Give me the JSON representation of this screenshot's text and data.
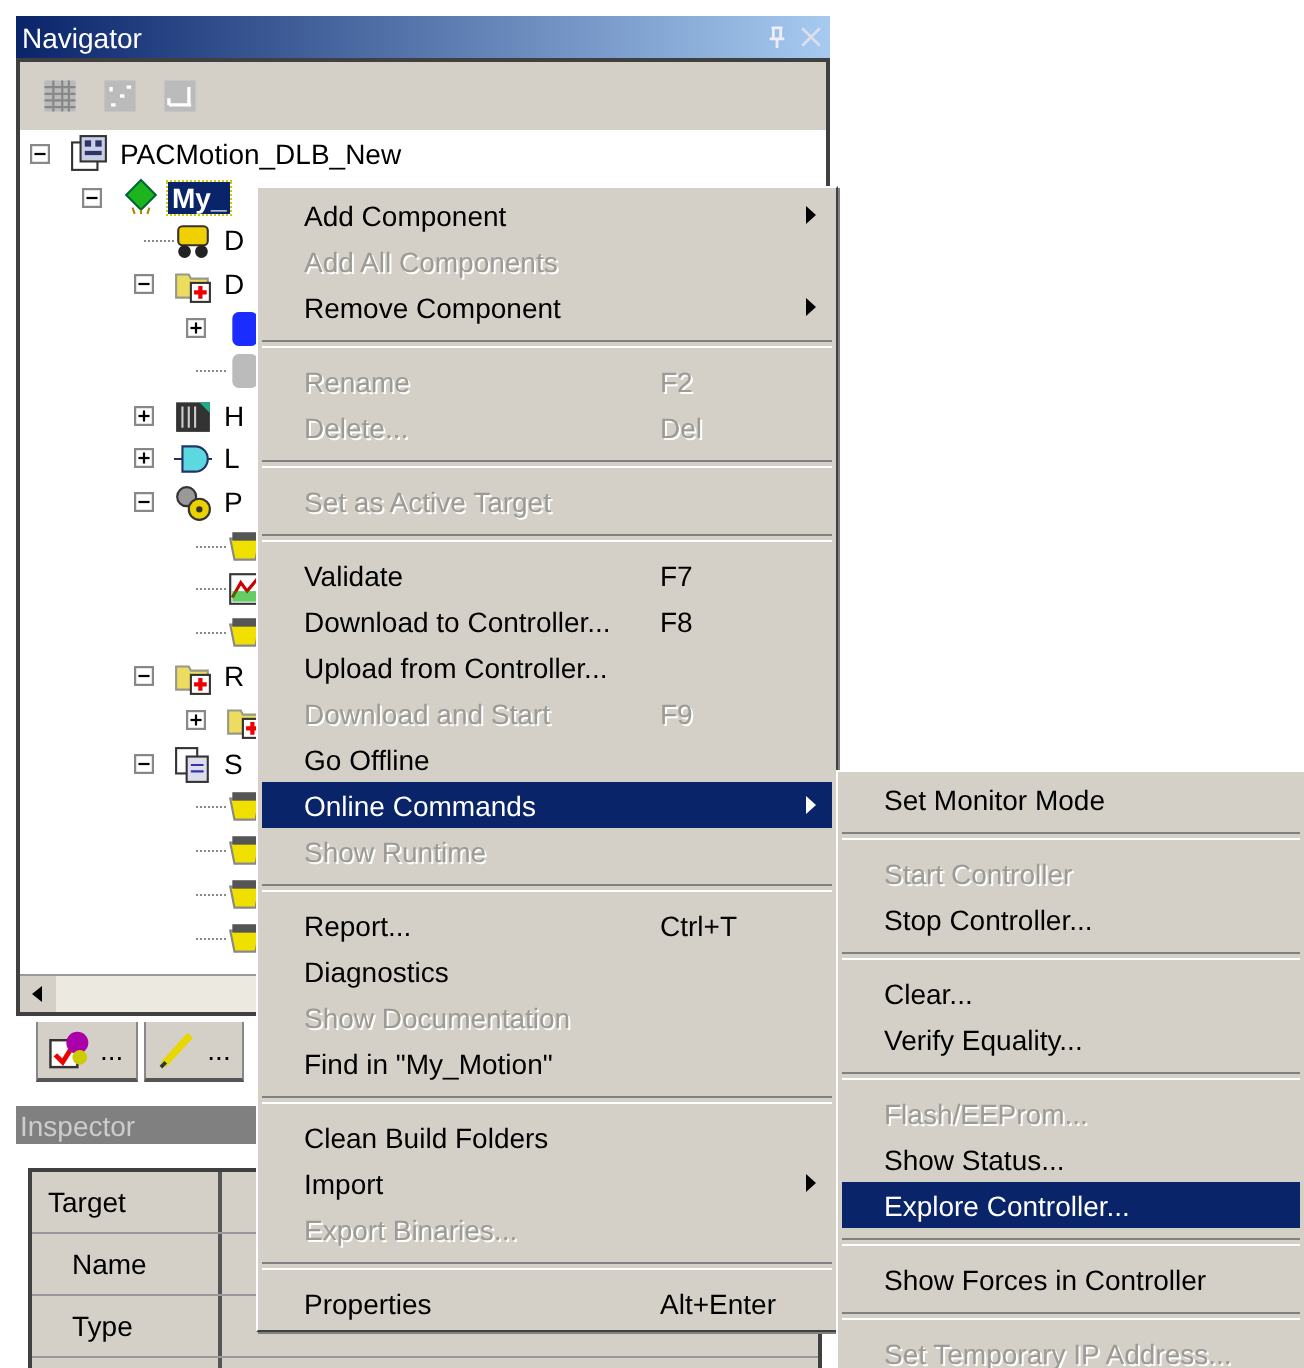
{
  "navigator": {
    "title": "Navigator",
    "tree": [
      {
        "label": "PACMotion_DLB_New",
        "kind": "project",
        "expanded": true,
        "selected": false,
        "children": [
          {
            "label": "My_",
            "kind": "target",
            "expanded": true,
            "selected": true,
            "children": [
              {
                "label": "D",
                "kind": "device",
                "selected": false
              },
              {
                "label": "D",
                "kind": "folder",
                "expanded": true,
                "selected": false,
                "children": [
                  {
                    "kind": "blue",
                    "expanded": false
                  },
                  {
                    "kind": "grey"
                  }
                ]
              },
              {
                "label": "H",
                "kind": "hardware",
                "expanded": false,
                "selected": false
              },
              {
                "label": "L",
                "kind": "logic",
                "expanded": false,
                "selected": false
              },
              {
                "label": "P",
                "kind": "gear",
                "expanded": true,
                "selected": false,
                "children": [
                  {
                    "kind": "item"
                  },
                  {
                    "kind": "chart"
                  },
                  {
                    "kind": "item"
                  }
                ]
              },
              {
                "label": "R",
                "kind": "folder",
                "expanded": true,
                "selected": false,
                "children": [
                  {
                    "kind": "folder",
                    "expanded": false
                  }
                ]
              },
              {
                "label": "S",
                "kind": "pages",
                "expanded": true,
                "selected": false,
                "children": [
                  {
                    "kind": "item"
                  },
                  {
                    "kind": "item"
                  },
                  {
                    "kind": "item"
                  },
                  {
                    "kind": "item"
                  }
                ]
              }
            ]
          }
        ]
      }
    ]
  },
  "tool_tabs": [
    {
      "label": "..."
    },
    {
      "label": "..."
    }
  ],
  "inspector": {
    "title": "Inspector",
    "rows": [
      {
        "kind": "category",
        "label": "Target"
      },
      {
        "kind": "property",
        "label": "Name"
      },
      {
        "kind": "property",
        "label": "Type"
      }
    ]
  },
  "context_menu": [
    {
      "kind": "item",
      "label": "Add Component",
      "disabled": false,
      "submenu": true,
      "selected": false
    },
    {
      "kind": "item",
      "label": "Add All Components",
      "disabled": true,
      "submenu": false,
      "selected": false
    },
    {
      "kind": "item",
      "label": "Remove Component",
      "disabled": false,
      "submenu": true,
      "selected": false
    },
    {
      "kind": "separator"
    },
    {
      "kind": "item",
      "label": "Rename",
      "shortcut": "F2",
      "disabled": true,
      "submenu": false,
      "selected": false
    },
    {
      "kind": "item",
      "label": "Delete...",
      "shortcut": "Del",
      "disabled": true,
      "submenu": false,
      "selected": false
    },
    {
      "kind": "separator"
    },
    {
      "kind": "item",
      "label": "Set as Active Target",
      "disabled": true,
      "submenu": false,
      "selected": false
    },
    {
      "kind": "separator"
    },
    {
      "kind": "item",
      "label": "Validate",
      "shortcut": "F7",
      "disabled": false,
      "submenu": false,
      "selected": false
    },
    {
      "kind": "item",
      "label": "Download to Controller...",
      "shortcut": "F8",
      "disabled": false,
      "submenu": false,
      "selected": false
    },
    {
      "kind": "item",
      "label": "Upload from Controller...",
      "disabled": false,
      "submenu": false,
      "selected": false
    },
    {
      "kind": "item",
      "label": "Download and Start",
      "shortcut": "F9",
      "disabled": true,
      "submenu": false,
      "selected": false
    },
    {
      "kind": "item",
      "label": "Go Offline",
      "disabled": false,
      "submenu": false,
      "selected": false
    },
    {
      "kind": "item",
      "label": "Online Commands",
      "disabled": false,
      "submenu": true,
      "selected": true
    },
    {
      "kind": "item",
      "label": "Show Runtime",
      "disabled": true,
      "submenu": false,
      "selected": false
    },
    {
      "kind": "separator"
    },
    {
      "kind": "item",
      "label": "Report...",
      "shortcut": "Ctrl+T",
      "disabled": false,
      "submenu": false,
      "selected": false
    },
    {
      "kind": "item",
      "label": "Diagnostics",
      "disabled": false,
      "submenu": false,
      "selected": false
    },
    {
      "kind": "item",
      "label": "Show Documentation",
      "disabled": true,
      "submenu": false,
      "selected": false
    },
    {
      "kind": "item",
      "label": "Find in \"My_Motion\"",
      "disabled": false,
      "submenu": false,
      "selected": false
    },
    {
      "kind": "separator"
    },
    {
      "kind": "item",
      "label": "Clean Build Folders",
      "disabled": false,
      "submenu": false,
      "selected": false
    },
    {
      "kind": "item",
      "label": "Import",
      "disabled": false,
      "submenu": true,
      "selected": false
    },
    {
      "kind": "item",
      "label": "Export Binaries...",
      "disabled": true,
      "submenu": false,
      "selected": false
    },
    {
      "kind": "separator"
    },
    {
      "kind": "item",
      "label": "Properties",
      "shortcut": "Alt+Enter",
      "disabled": false,
      "submenu": false,
      "selected": false
    }
  ],
  "submenu": [
    {
      "kind": "item",
      "label": "Set Monitor Mode",
      "disabled": false,
      "selected": false
    },
    {
      "kind": "separator"
    },
    {
      "kind": "item",
      "label": "Start Controller",
      "disabled": true,
      "selected": false
    },
    {
      "kind": "item",
      "label": "Stop Controller...",
      "disabled": false,
      "selected": false
    },
    {
      "kind": "separator"
    },
    {
      "kind": "item",
      "label": "Clear...",
      "disabled": false,
      "selected": false
    },
    {
      "kind": "item",
      "label": "Verify Equality...",
      "disabled": false,
      "selected": false
    },
    {
      "kind": "separator"
    },
    {
      "kind": "item",
      "label": "Flash/EEProm...",
      "disabled": true,
      "selected": false
    },
    {
      "kind": "item",
      "label": "Show Status...",
      "disabled": false,
      "selected": false
    },
    {
      "kind": "item",
      "label": "Explore Controller...",
      "disabled": false,
      "selected": true
    },
    {
      "kind": "separator"
    },
    {
      "kind": "item",
      "label": "Show Forces in Controller",
      "disabled": false,
      "selected": false
    },
    {
      "kind": "separator"
    },
    {
      "kind": "item",
      "label": "Set Temporary IP Address...",
      "disabled": true,
      "selected": false
    }
  ]
}
